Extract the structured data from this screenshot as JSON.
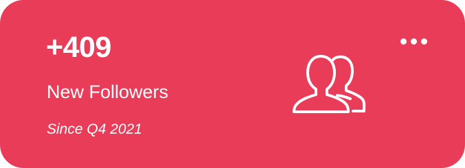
{
  "card": {
    "value": "+409",
    "label": "New Followers",
    "period": "Since Q4 2021",
    "background_color": "#e83c59",
    "text_color": "#ffffff",
    "icon": "users-icon",
    "menu_icon": "more-horizontal-icon"
  }
}
